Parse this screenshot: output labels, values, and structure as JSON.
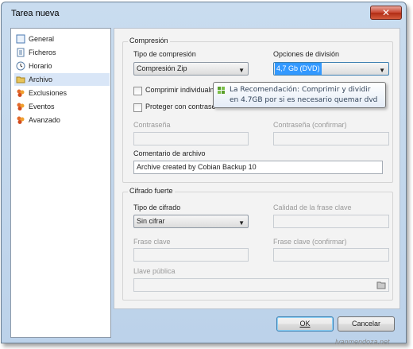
{
  "window": {
    "title": "Tarea nueva",
    "close_glyph": "✕"
  },
  "sidebar": {
    "items": [
      {
        "label": "General",
        "icon": "general-page-icon",
        "selected": false
      },
      {
        "label": "Ficheros",
        "icon": "files-icon",
        "selected": false
      },
      {
        "label": "Horario",
        "icon": "clock-icon",
        "selected": false
      },
      {
        "label": "Archivo",
        "icon": "folder-icon",
        "selected": true
      },
      {
        "label": "Exclusiones",
        "icon": "exclusions-icon",
        "selected": false
      },
      {
        "label": "Eventos",
        "icon": "events-icon",
        "selected": false
      },
      {
        "label": "Avanzado",
        "icon": "advanced-icon",
        "selected": false
      }
    ]
  },
  "compression": {
    "group_title": "Compresión",
    "type_label": "Tipo de compresión",
    "type_value": "Compresión Zip",
    "split_label": "Opciones de división",
    "split_value": "4,7 Gb (DVD)",
    "compress_individually_label": "Comprimir individualme",
    "protect_label": "Proteger con contrase",
    "password_label": "Contraseña",
    "password_confirm_label": "Contraseña (confirmar)",
    "comment_label": "Comentario de archivo",
    "comment_value": "Archive created by Cobian Backup 10"
  },
  "tooltip": {
    "text_line1": "La Recomendación: Comprimir y dividir",
    "text_line2": "en 4.7GB por si es necesario quemar dvd",
    "icon": "tip-grid-icon"
  },
  "encryption": {
    "group_title": "Cifrado fuerte",
    "type_label": "Tipo de cifrado",
    "type_value": "Sin cifrar",
    "quality_label": "Calidad de la frase clave",
    "passphrase_label": "Frase clave",
    "passphrase_confirm_label": "Frase clave (confirmar)",
    "public_key_label": "Llave pública"
  },
  "buttons": {
    "ok_label": "OK",
    "cancel_label": "Cancelar"
  },
  "watermark": "lvanmendoza.net",
  "colors": {
    "selected_bg": "#d9e6f7",
    "highlight": "#3399ff",
    "close_red": "#c8452f",
    "window_blue": "#c9dcef"
  }
}
